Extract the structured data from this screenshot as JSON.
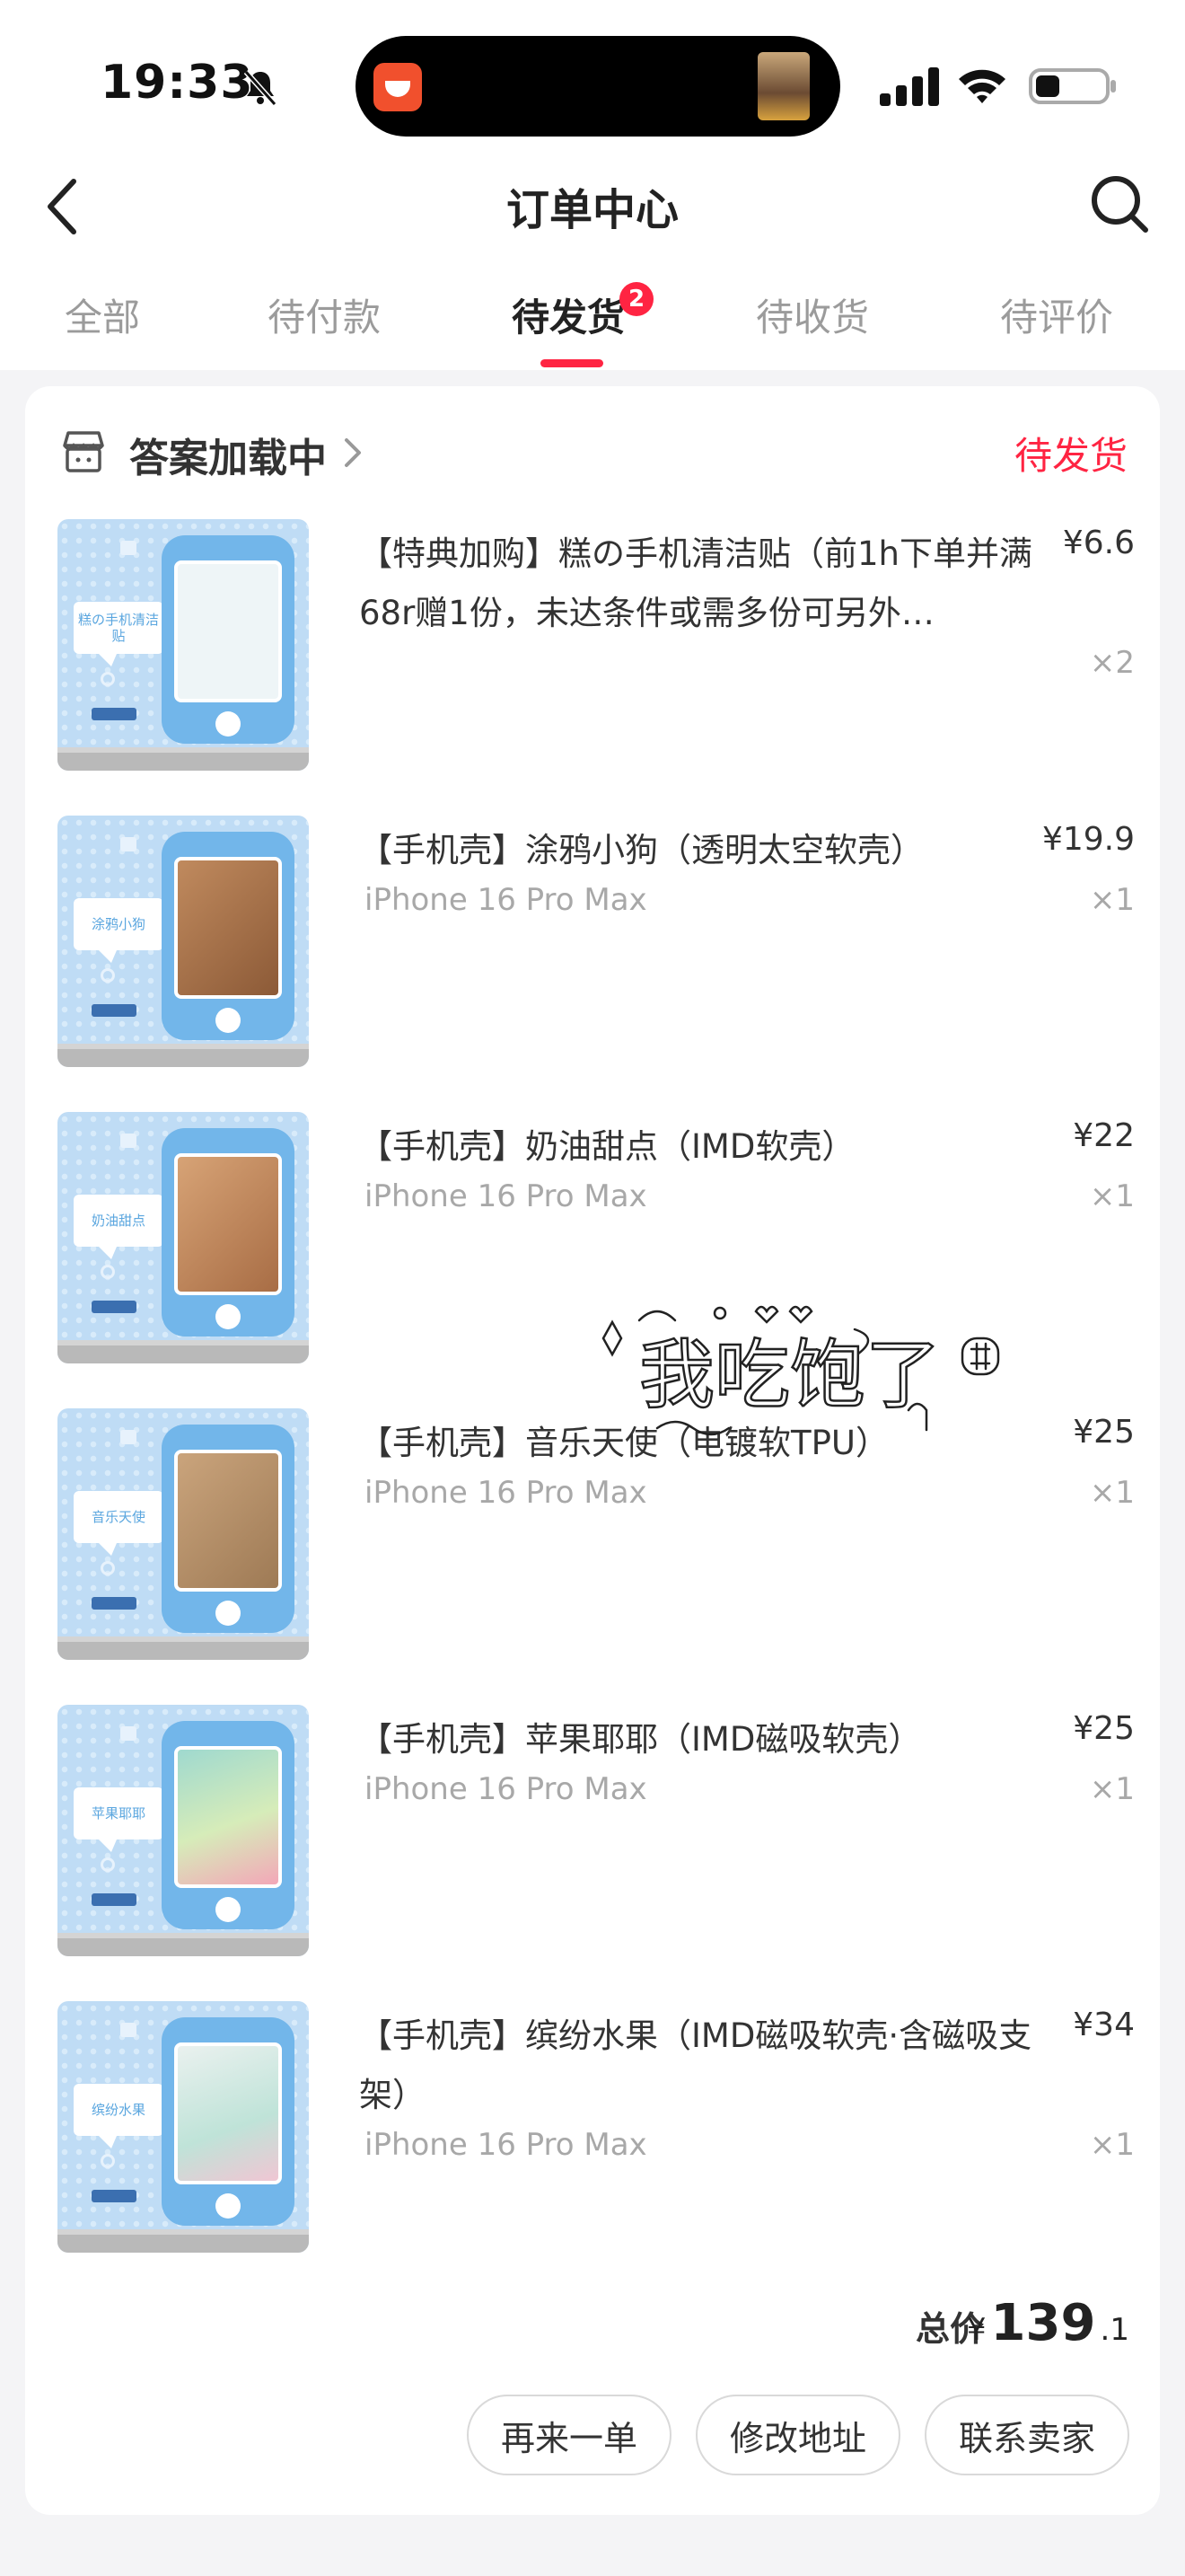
{
  "status_bar": {
    "time": "19:33"
  },
  "nav": {
    "title": "订单中心"
  },
  "tabs": [
    {
      "label": "全部"
    },
    {
      "label": "待付款"
    },
    {
      "label": "待发货",
      "active": true,
      "badge": "2"
    },
    {
      "label": "待收货"
    },
    {
      "label": "待评价"
    }
  ],
  "order": {
    "shop_name": "答案加载中",
    "status": "待发货",
    "items": [
      {
        "title": "【特典加购】糕の手机清洁贴（前1h下单并满68r赠1份，未达条件或需多份可另外…",
        "variant": "",
        "price": "¥6.6",
        "qty": "×2",
        "thumb_label": "糕の手机清洁贴"
      },
      {
        "title": "【手机壳】涂鸦小狗（透明太空软壳）",
        "variant": "iPhone 16 Pro Max",
        "price": "¥19.9",
        "qty": "×1",
        "thumb_label": "涂鸦小狗"
      },
      {
        "title": "【手机壳】奶油甜点（IMD软壳）",
        "variant": "iPhone 16 Pro Max",
        "price": "¥22",
        "qty": "×1",
        "thumb_label": "奶油甜点"
      },
      {
        "title": "【手机壳】音乐天使（电镀软TPU）",
        "variant": "iPhone 16 Pro Max",
        "price": "¥25",
        "qty": "×1",
        "thumb_label": "音乐天使"
      },
      {
        "title": "【手机壳】苹果耶耶（IMD磁吸软壳）",
        "variant": "iPhone 16 Pro Max",
        "price": "¥25",
        "qty": "×1",
        "thumb_label": "苹果耶耶"
      },
      {
        "title": "【手机壳】缤纷水果（IMD磁吸软壳·含磁吸支架）",
        "variant": "iPhone 16 Pro Max",
        "price": "¥34",
        "qty": "×1",
        "thumb_label": "缤纷水果"
      }
    ],
    "total_label": "总价",
    "total_currency": "¥",
    "total_int": "139",
    "total_dec": ".1",
    "actions": [
      "再来一单",
      "修改地址",
      "联系卖家"
    ]
  },
  "watermark_text": "我吃饱了",
  "colors": {
    "accent": "#ff2442",
    "thumb_bg": "#bfdcf5",
    "phone": "#72b6ea"
  }
}
